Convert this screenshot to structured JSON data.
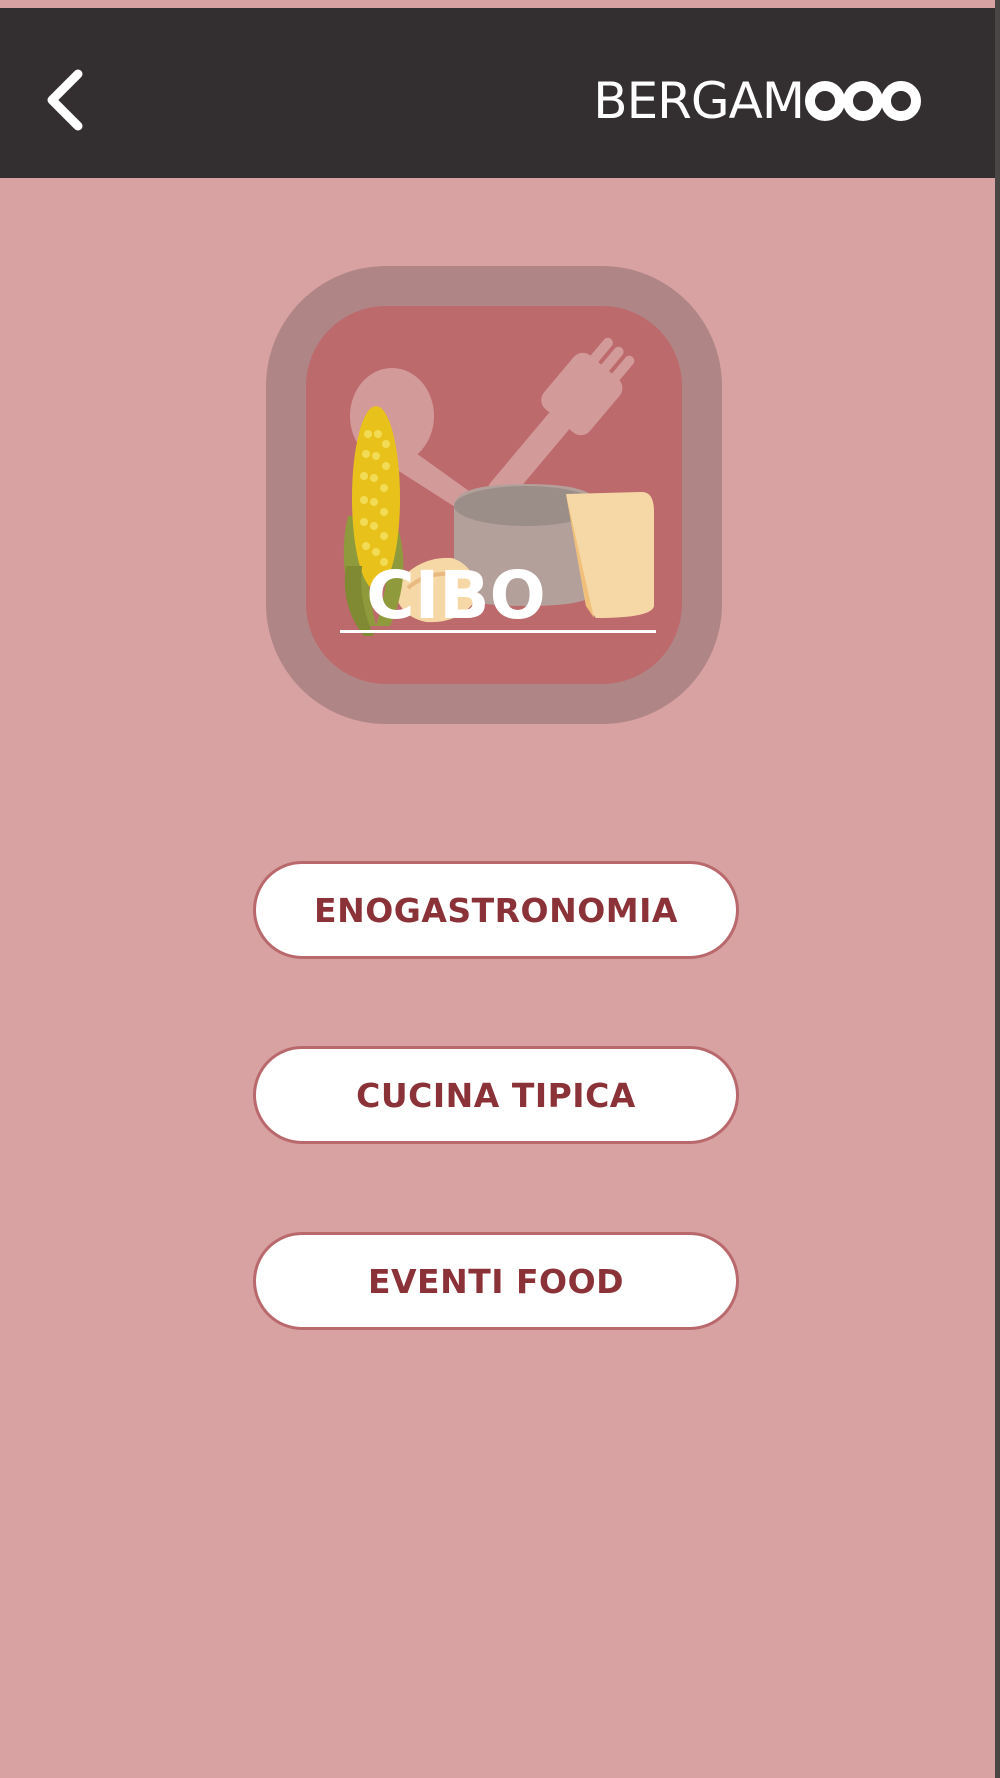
{
  "header": {
    "back_icon": "chevron-left-icon",
    "brand_text": "BERGAM",
    "brand_suffix_icon": "three-circles-logo"
  },
  "logo": {
    "label": "CIBO",
    "icons": [
      "spoon-icon",
      "fork-icon",
      "corn-icon",
      "cheese-icon",
      "pasta-icon"
    ]
  },
  "menu": {
    "items": [
      {
        "label": "ENOGASTRONOMIA"
      },
      {
        "label": "CUCINA TIPICA"
      },
      {
        "label": "EVENTI FOOD"
      }
    ]
  },
  "colors": {
    "header_bg": "#332e2f",
    "page_bg": "#d8a1a2",
    "badge_outer": "#b08586",
    "badge_inner": "#bd6a6c",
    "button_border": "#b9686c",
    "button_text": "#8b3238",
    "corn": "#e8c21a",
    "husk": "#8f9a3c",
    "cheese": "#f6d8a6"
  }
}
